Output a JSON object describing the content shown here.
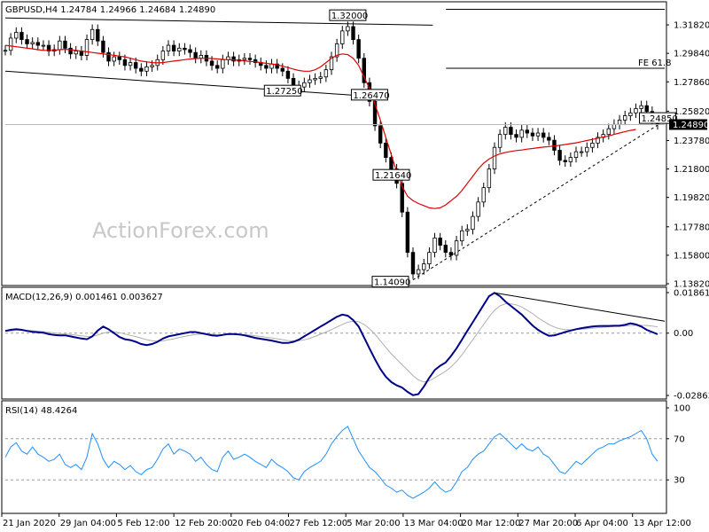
{
  "chart_data": [
    {
      "type": "candlestick",
      "panel": "price",
      "title": "GBPUSD,H4  1.24784 1.24966 1.24684 1.24890",
      "ylim": [
        1.1382,
        1.3318
      ],
      "y_ticks": [
        "1.31820",
        "1.29840",
        "1.27860",
        "1.25820",
        "1.23780",
        "1.21800",
        "1.19820",
        "1.17780",
        "1.15800",
        "1.13820"
      ],
      "last_price_label": "1.24890",
      "last_price": 1.2489,
      "series": [
        {
          "name": "",
          "kind": "close-path",
          "values": [
            1.3005,
            1.309,
            1.313,
            1.308,
            1.305,
            1.306,
            1.304,
            1.304,
            1.3,
            1.301,
            1.307,
            1.302,
            1.298,
            1.3,
            1.297,
            1.308,
            1.315,
            1.307,
            1.299,
            1.293,
            1.296,
            1.294,
            1.29,
            1.292,
            1.288,
            1.286,
            1.289,
            1.29,
            1.294,
            1.3,
            1.304,
            1.3,
            1.302,
            1.301,
            1.299,
            1.295,
            1.297,
            1.293,
            1.29,
            1.288,
            1.294,
            1.296,
            1.293,
            1.294,
            1.295,
            1.294,
            1.292,
            1.29,
            1.288,
            1.291,
            1.288,
            1.286,
            1.281,
            1.276,
            1.275,
            1.278,
            1.28,
            1.281,
            1.282,
            1.287,
            1.296,
            1.305,
            1.314,
            1.317,
            1.308,
            1.295,
            1.278,
            1.265,
            1.248,
            1.236,
            1.226,
            1.218,
            1.208,
            1.188,
            1.16,
            1.145,
            1.148,
            1.152,
            1.16,
            1.17,
            1.165,
            1.16,
            1.158,
            1.168,
            1.175,
            1.176,
            1.185,
            1.195,
            1.205,
            1.218,
            1.233,
            1.242,
            1.247,
            1.242,
            1.24,
            1.245,
            1.243,
            1.241,
            1.243,
            1.24,
            1.238,
            1.231,
            1.224,
            1.223,
            1.226,
            1.23,
            1.23,
            1.233,
            1.236,
            1.24,
            1.242,
            1.246,
            1.249,
            1.252,
            1.255,
            1.257,
            1.26,
            1.262,
            1.258,
            1.252,
            1.2489
          ]
        },
        {
          "name": "",
          "kind": "moving-average",
          "color": "#e00000",
          "values": [
            1.304,
            1.3035,
            1.303,
            1.3025,
            1.302,
            1.3015,
            1.301,
            1.3005,
            1.3005,
            1.3005,
            1.301,
            1.3012,
            1.301,
            1.3005,
            1.3,
            1.2995,
            1.299,
            1.2985,
            1.298,
            1.2975,
            1.297,
            1.2965,
            1.296,
            1.295,
            1.294,
            1.293,
            1.2925,
            1.292,
            1.2918,
            1.292,
            1.2925,
            1.293,
            1.2935,
            1.294,
            1.2945,
            1.2948,
            1.295,
            1.295,
            1.2948,
            1.2945,
            1.2942,
            1.294,
            1.2938,
            1.2935,
            1.2932,
            1.2928,
            1.2925,
            1.292,
            1.2915,
            1.291,
            1.2905,
            1.2895,
            1.2885,
            1.2875,
            1.2865,
            1.286,
            1.286,
            1.287,
            1.289,
            1.292,
            1.295,
            1.297,
            1.298,
            1.2975,
            1.295,
            1.29,
            1.282,
            1.274,
            1.263,
            1.252,
            1.24,
            1.228,
            1.216,
            1.206,
            1.199,
            1.196,
            1.194,
            1.1925,
            1.191,
            1.1905,
            1.191,
            1.193,
            1.196,
            1.199,
            1.203,
            1.208,
            1.213,
            1.218,
            1.222,
            1.225,
            1.227,
            1.2285,
            1.2295,
            1.2302,
            1.2308,
            1.2312,
            1.2318,
            1.2322,
            1.2328,
            1.2332,
            1.2336,
            1.234,
            1.2345,
            1.235,
            1.2356,
            1.2362,
            1.237,
            1.2378,
            1.2386,
            1.2394,
            1.2402,
            1.241,
            1.242,
            1.243,
            1.244,
            1.2448,
            1.2455
          ]
        }
      ],
      "annotations": [
        {
          "label": "1.32000",
          "value": 1.32
        },
        {
          "label": "1.27250",
          "value": 1.2725
        },
        {
          "label": "1.14090",
          "value": 1.1409
        },
        {
          "label": "1.24850",
          "value": 1.2485
        },
        {
          "label": "1.21640",
          "value": 1.2164
        },
        {
          "label": "1.26470",
          "value": 1.2647
        },
        {
          "label": "FE 61.8",
          "value": 1.288
        }
      ],
      "watermark": "ActionForex.com"
    },
    {
      "type": "line",
      "panel": "macd",
      "title": "MACD(12,26,9) 0.001461 0.003627",
      "ylim": [
        -0.028631,
        0.018615
      ],
      "y_ticks": [
        "0.018615",
        "0.00",
        "-0.028631"
      ],
      "series": [
        {
          "name": "",
          "color": "#00008b",
          "values": [
            0.001,
            0.0015,
            0.0018,
            0.0015,
            0.001,
            0.0006,
            0.0004,
            0.0002,
            -0.0005,
            -0.0008,
            -0.001,
            -0.001,
            -0.0015,
            -0.002,
            -0.0025,
            -0.0028,
            -0.0015,
            0.0012,
            0.003,
            0.0018,
            0.0,
            -0.0018,
            -0.0028,
            -0.0032,
            -0.004,
            -0.005,
            -0.0055,
            -0.005,
            -0.004,
            -0.0025,
            -0.0015,
            -0.001,
            -0.0005,
            0.0,
            0.0005,
            0.0005,
            0.0,
            -0.0005,
            -0.001,
            -0.0012,
            -0.0008,
            -0.0004,
            -0.0004,
            -0.0006,
            -0.001,
            -0.0016,
            -0.0022,
            -0.0026,
            -0.003,
            -0.0034,
            -0.004,
            -0.0045,
            -0.0045,
            -0.004,
            -0.003,
            -0.0015,
            0.0,
            0.0015,
            0.003,
            0.0045,
            0.006,
            0.0075,
            0.0085,
            0.008,
            0.006,
            0.003,
            -0.002,
            -0.007,
            -0.012,
            -0.0165,
            -0.02,
            -0.0225,
            -0.024,
            -0.025,
            -0.027,
            -0.0285,
            -0.028,
            -0.0245,
            -0.0205,
            -0.017,
            -0.015,
            -0.0135,
            -0.0105,
            -0.007,
            -0.003,
            0.001,
            0.005,
            0.009,
            0.013,
            0.017,
            0.0185,
            0.017,
            0.0145,
            0.0125,
            0.0105,
            0.0085,
            0.006,
            0.0035,
            0.0015,
            0.0,
            -0.0012,
            -0.001,
            -0.0003,
            0.0005,
            0.0012,
            0.0018,
            0.0023,
            0.0027,
            0.003,
            0.0032,
            0.0033,
            0.0033,
            0.0034,
            0.0034,
            0.0038,
            0.0045,
            0.004,
            0.003,
            0.0015,
            0.0005,
            -0.0005
          ]
        },
        {
          "name": "",
          "color": "#b0b0b0",
          "values": [
            0.0008,
            0.001,
            0.0013,
            0.0014,
            0.0013,
            0.0011,
            0.0009,
            0.0007,
            0.0004,
            0.0001,
            -0.0002,
            -0.0004,
            -0.0006,
            -0.0009,
            -0.0012,
            -0.0015,
            -0.0015,
            -0.0009,
            0.0,
            0.0005,
            0.0006,
            0.0002,
            -0.0004,
            -0.001,
            -0.0016,
            -0.0023,
            -0.003,
            -0.0035,
            -0.0037,
            -0.0036,
            -0.0031,
            -0.0026,
            -0.002,
            -0.0015,
            -0.001,
            -0.0006,
            -0.0004,
            -0.0004,
            -0.0005,
            -0.0007,
            -0.0008,
            -0.0007,
            -0.0006,
            -0.0006,
            -0.0007,
            -0.0009,
            -0.0012,
            -0.0015,
            -0.0019,
            -0.0022,
            -0.0026,
            -0.003,
            -0.0034,
            -0.0036,
            -0.0035,
            -0.0031,
            -0.0024,
            -0.0015,
            -0.0005,
            0.0005,
            0.0016,
            0.0028,
            0.004,
            0.005,
            0.0055,
            0.0052,
            0.004,
            0.002,
            -0.0005,
            -0.0035,
            -0.0065,
            -0.0095,
            -0.012,
            -0.0145,
            -0.017,
            -0.0195,
            -0.0215,
            -0.0225,
            -0.022,
            -0.0205,
            -0.019,
            -0.0175,
            -0.0155,
            -0.013,
            -0.01,
            -0.0065,
            -0.003,
            0.0005,
            0.004,
            0.0075,
            0.0105,
            0.0125,
            0.0135,
            0.0135,
            0.013,
            0.012,
            0.0105,
            0.009,
            0.007,
            0.0055,
            0.004,
            0.0028,
            0.002,
            0.0016,
            0.0015,
            0.0016,
            0.0018,
            0.002,
            0.0023,
            0.0025,
            0.0027,
            0.0029,
            0.003,
            0.0031,
            0.0033,
            0.0035,
            0.0036,
            0.0036,
            0.0035,
            0.0032,
            0.0029
          ]
        }
      ],
      "zero_line": 0,
      "trendline": [
        {
          "value": 0.0185
        },
        {
          "value": 0.0055
        }
      ]
    },
    {
      "type": "line",
      "panel": "rsi",
      "title": "RSI(14) 48.4264",
      "ylim": [
        0,
        100
      ],
      "y_ticks": [
        "100",
        "70",
        "30",
        "0"
      ],
      "levels": [
        70,
        30
      ],
      "series": [
        {
          "name": "",
          "color": "#1e90ff",
          "values": [
            52,
            62,
            66,
            58,
            55,
            62,
            55,
            52,
            48,
            50,
            55,
            45,
            42,
            45,
            40,
            52,
            75,
            65,
            50,
            42,
            48,
            45,
            40,
            44,
            38,
            35,
            40,
            42,
            50,
            60,
            65,
            55,
            60,
            58,
            55,
            48,
            52,
            45,
            40,
            38,
            52,
            58,
            50,
            52,
            55,
            52,
            48,
            45,
            42,
            50,
            45,
            42,
            38,
            32,
            30,
            38,
            42,
            45,
            48,
            55,
            65,
            72,
            78,
            82,
            70,
            58,
            50,
            42,
            38,
            32,
            25,
            22,
            18,
            20,
            15,
            12,
            15,
            18,
            22,
            28,
            22,
            18,
            20,
            28,
            38,
            42,
            50,
            55,
            58,
            65,
            72,
            75,
            70,
            65,
            60,
            65,
            60,
            58,
            62,
            55,
            52,
            45,
            38,
            36,
            42,
            48,
            45,
            50,
            55,
            60,
            62,
            65,
            65,
            68,
            70,
            72,
            75,
            78,
            70,
            55,
            48
          ]
        }
      ]
    }
  ],
  "x_axis_labels": [
    "21 Jan 2020",
    "29 Jan 04:00",
    "5 Feb 12:00",
    "12 Feb 20:00",
    "20 Feb 04:00",
    "27 Feb 12:00",
    "5 Mar 20:00",
    "13 Mar 04:00",
    "20 Mar 12:00",
    "27 Mar 20:00",
    "6 Apr 04:00",
    "13 Apr 12:00"
  ],
  "colors": {
    "ma": "#e00000",
    "macd": "#00008b",
    "signal": "#b0b0b0",
    "rsi": "#1e90ff",
    "candle": "#000000"
  }
}
